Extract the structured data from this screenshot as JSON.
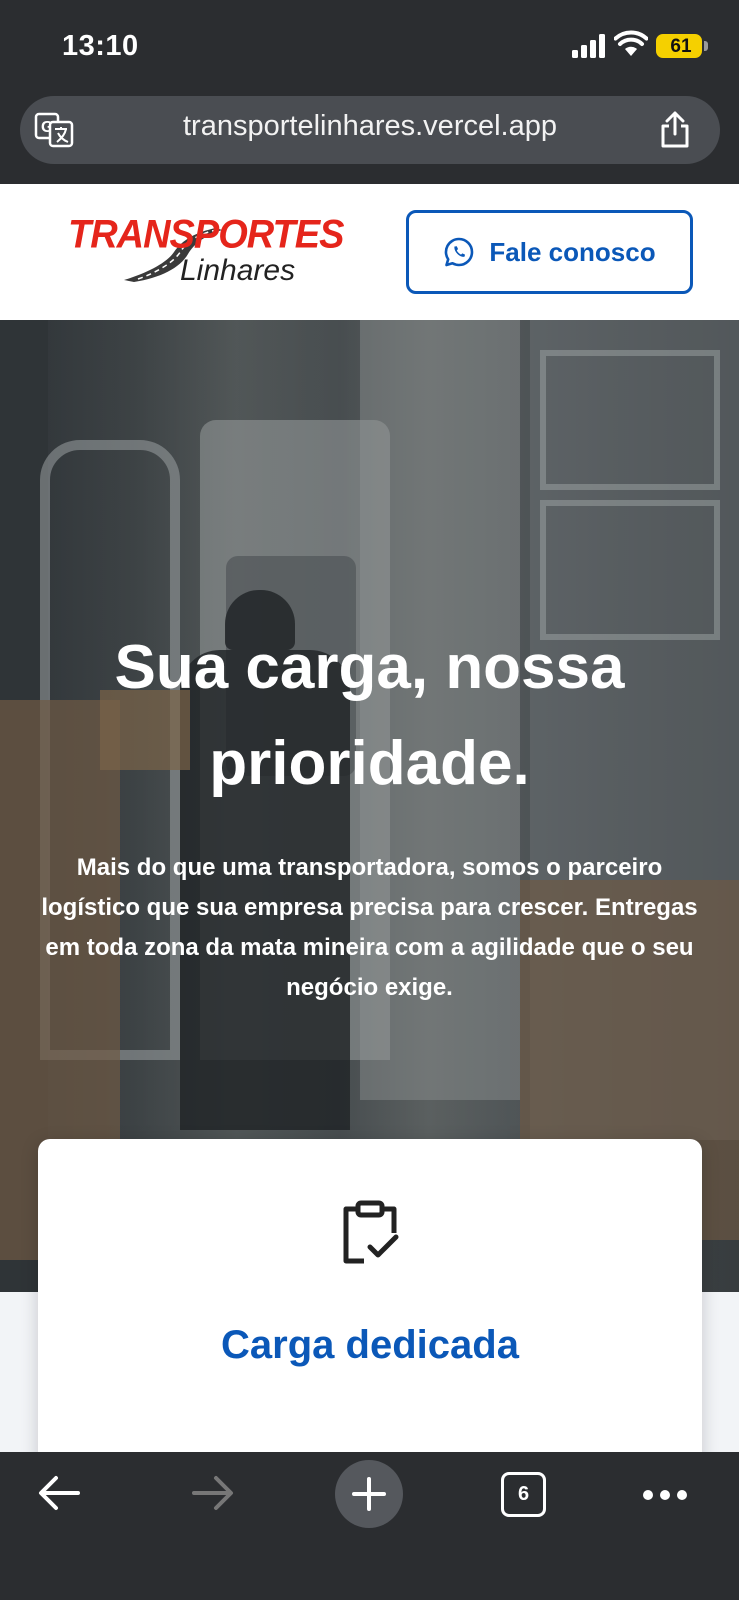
{
  "status_bar": {
    "time": "13:10",
    "battery": "61",
    "icons": [
      "cellular-signal-icon",
      "wifi-icon",
      "battery-icon"
    ]
  },
  "browser": {
    "url": "transportelinhares.vercel.app",
    "icons": [
      "translate-icon",
      "share-icon"
    ],
    "toolbar": {
      "tab_count": "6",
      "icons": [
        "back-arrow-icon",
        "forward-arrow-icon",
        "new-tab-plus-icon",
        "tabs-icon",
        "more-icon"
      ]
    }
  },
  "header": {
    "logo": {
      "line1": "TRANSPORTES",
      "line2": "Linhares"
    },
    "cta_label": "Fale conosco",
    "cta_icon": "whatsapp-icon"
  },
  "hero": {
    "title": "Sua carga, nossa prioridade.",
    "subtitle": "Mais do que uma transportadora, somos o parceiro logístico que sua empresa precisa para crescer. Entregas em toda zona da mata mineira com a agilidade que o seu negócio exige."
  },
  "service_card": {
    "icon": "clipboard-check-icon",
    "title": "Carga dedicada"
  },
  "colors": {
    "brand_blue": "#0b58b8",
    "brand_red": "#e5251b",
    "chrome_dark": "#2b2d30",
    "battery_yellow": "#f5d000"
  }
}
